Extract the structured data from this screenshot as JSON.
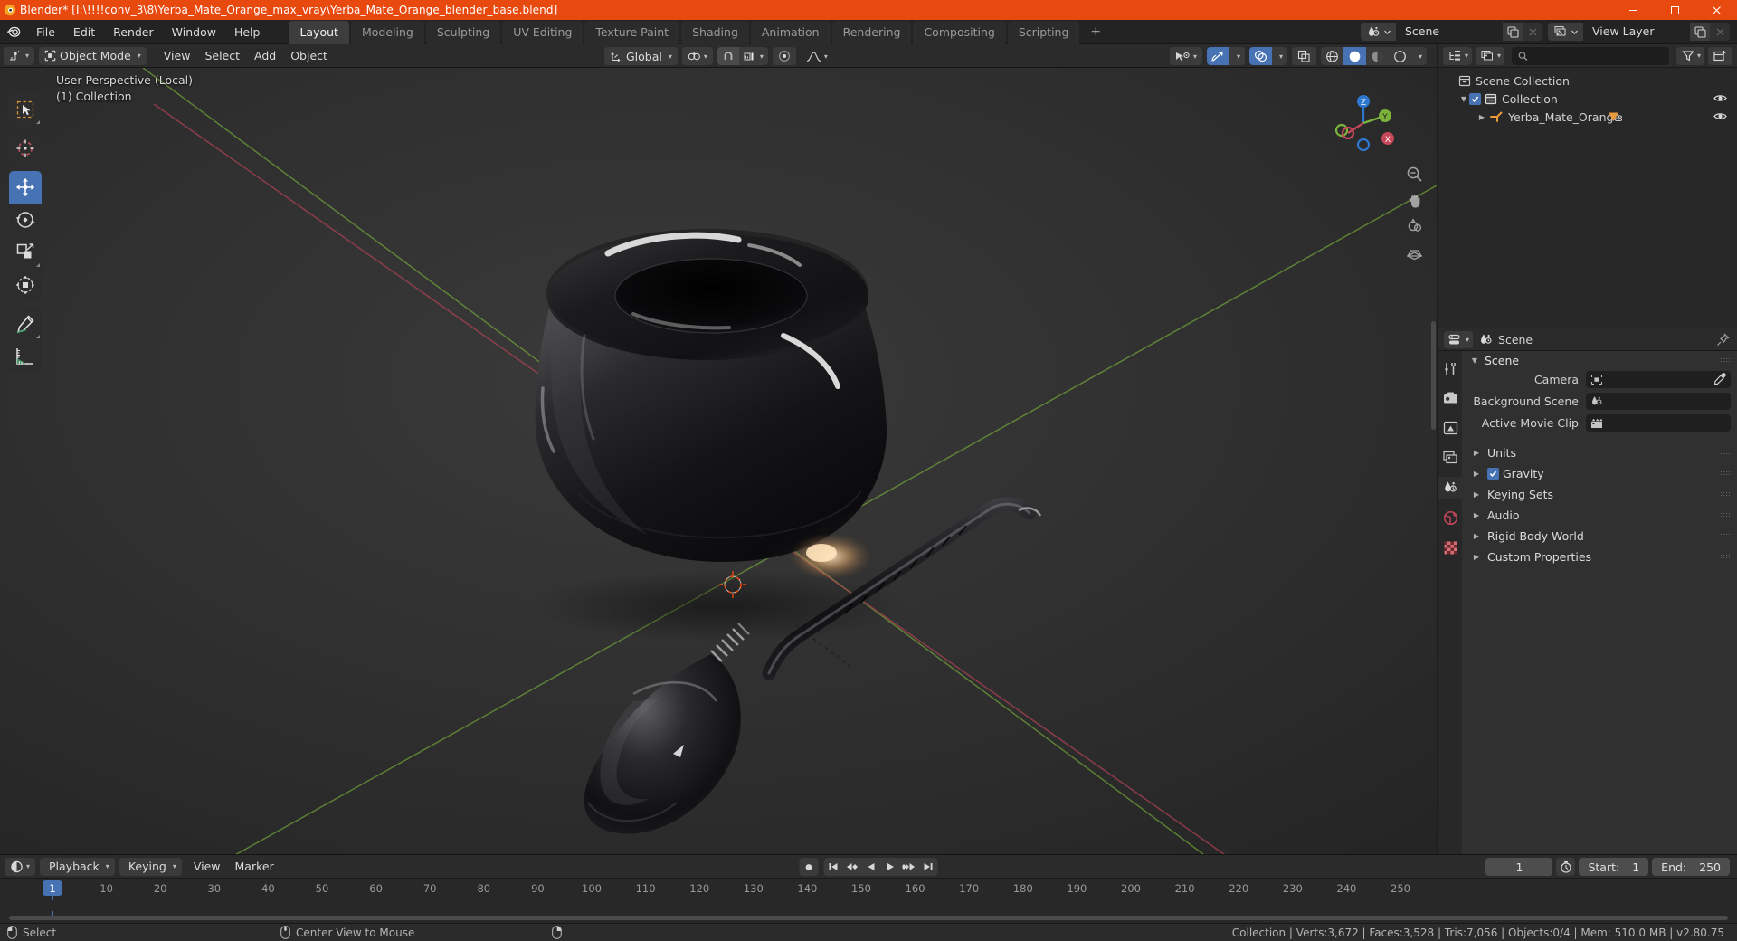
{
  "window": {
    "title": "Blender* [I:\\!!!!conv_3\\8\\Yerba_Mate_Orange_max_vray\\Yerba_Mate_Orange_blender_base.blend]",
    "minimize": "—",
    "maximize": "❐",
    "close": "✕"
  },
  "menubar": {
    "items": [
      "File",
      "Edit",
      "Render",
      "Window",
      "Help"
    ],
    "workspaces": [
      {
        "label": "Layout",
        "active": true
      },
      {
        "label": "Modeling",
        "active": false
      },
      {
        "label": "Sculpting",
        "active": false
      },
      {
        "label": "UV Editing",
        "active": false
      },
      {
        "label": "Texture Paint",
        "active": false
      },
      {
        "label": "Shading",
        "active": false
      },
      {
        "label": "Animation",
        "active": false
      },
      {
        "label": "Rendering",
        "active": false
      },
      {
        "label": "Compositing",
        "active": false
      },
      {
        "label": "Scripting",
        "active": false
      }
    ],
    "add_workspace": "+",
    "scene_value": "Scene",
    "viewlayer_value": "View Layer"
  },
  "viewport": {
    "mode": "Object Mode",
    "menus": [
      "View",
      "Select",
      "Add",
      "Object"
    ],
    "transform_orientation": "Global",
    "overlay_line1": "User Perspective (Local)",
    "overlay_line2": "(1) Collection",
    "gizmo_axes": {
      "x": "X",
      "y": "Y",
      "z": "Z"
    },
    "tools": [
      {
        "name": "tweak-select-box",
        "active": false
      },
      {
        "name": "cursor",
        "active": false
      },
      {
        "name": "move",
        "active": true
      },
      {
        "name": "rotate",
        "active": false
      },
      {
        "name": "scale",
        "active": false
      },
      {
        "name": "transform",
        "active": false
      },
      {
        "name": "annotate",
        "active": false
      },
      {
        "name": "measure",
        "active": false
      }
    ]
  },
  "outliner": {
    "search_placeholder": "",
    "rows": [
      {
        "label": "Scene Collection",
        "indent": 0,
        "type": "scene-collection",
        "has_tri": false,
        "has_checkbox": false,
        "eye": false
      },
      {
        "label": "Collection",
        "indent": 1,
        "type": "collection",
        "has_tri": true,
        "has_checkbox": true,
        "eye": true
      },
      {
        "label": "Yerba_Mate_Orange",
        "indent": 2,
        "type": "object-empty",
        "has_tri": true,
        "has_checkbox": false,
        "eye": true,
        "badge": "3"
      }
    ]
  },
  "properties": {
    "breadcrumb": "Scene",
    "panel_title": "Scene",
    "fields": [
      {
        "label": "Camera",
        "value": "",
        "icon": "camera-icon",
        "eyedropper": true
      },
      {
        "label": "Background Scene",
        "value": "",
        "icon": "scene-icon",
        "eyedropper": false
      },
      {
        "label": "Active Movie Clip",
        "value": "",
        "icon": "clip-icon",
        "eyedropper": false
      }
    ],
    "sections": [
      {
        "label": "Units",
        "checkbox": false
      },
      {
        "label": "Gravity",
        "checkbox": true,
        "checked": true
      },
      {
        "label": "Keying Sets",
        "checkbox": false
      },
      {
        "label": "Audio",
        "checkbox": false
      },
      {
        "label": "Rigid Body World",
        "checkbox": false
      },
      {
        "label": "Custom Properties",
        "checkbox": false
      }
    ]
  },
  "timeline": {
    "menus": [
      "Playback",
      "Keying",
      "View",
      "Marker"
    ],
    "current_frame": "1",
    "start_label": "Start:",
    "start_value": "1",
    "end_label": "End:",
    "end_value": "250",
    "ticks": [
      "10",
      "20",
      "30",
      "40",
      "50",
      "60",
      "70",
      "80",
      "90",
      "100",
      "110",
      "120",
      "130",
      "140",
      "150",
      "160",
      "170",
      "180",
      "190",
      "200",
      "210",
      "220",
      "230",
      "240",
      "250"
    ],
    "playhead_label": "1"
  },
  "statusbar": {
    "left_items": [
      {
        "icon": "mouse-left-icon",
        "label": "Select"
      },
      {
        "icon": "mouse-middle-icon",
        "label": "Center View to Mouse"
      },
      {
        "icon": "mouse-right-icon",
        "label": ""
      }
    ],
    "stats": "Collection | Verts:3,672 | Faces:3,528 | Tris:7,056 | Objects:0/4 | Mem: 510.0 MB | v2.80.75"
  },
  "colors": {
    "accent_orange": "#e8490f",
    "accent_blue": "#4772b3",
    "axis_x_red": "#c4475a",
    "axis_y_green": "#7bb23c",
    "axis_z_blue": "#2e77d0",
    "bg_dark": "#1d1d1d",
    "panel_bg": "#303030"
  }
}
